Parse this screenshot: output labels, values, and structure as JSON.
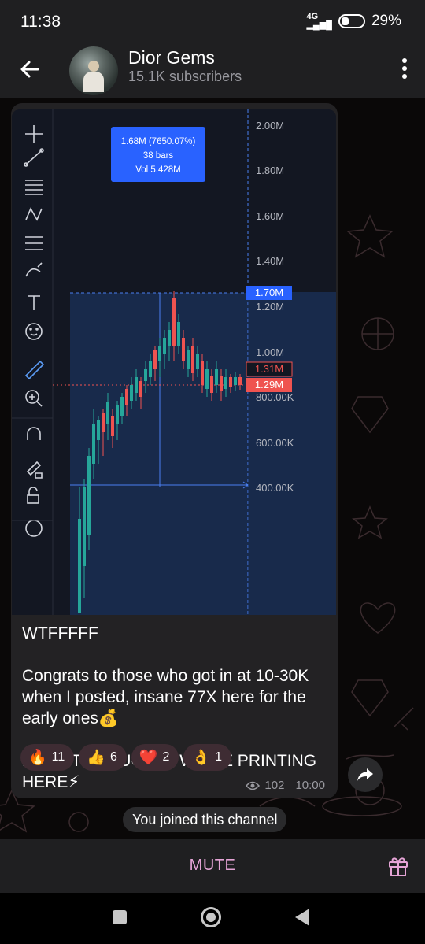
{
  "status": {
    "time": "11:38",
    "network": "4G",
    "battery": "29%"
  },
  "header": {
    "title": "Dior Gems",
    "subtitle": "15.1K subscribers"
  },
  "chart": {
    "tooltip": {
      "line1": "1.68M (7650.07%)",
      "line2": "38 bars",
      "line3": "Vol 5.428M"
    },
    "price_labels": [
      "2.00M",
      "1.80M",
      "1.60M",
      "1.40M",
      "1.20M",
      "1.00M",
      "800.00K",
      "600.00K",
      "400.00K"
    ],
    "highlight_labels": {
      "top": "1.70M",
      "mid": "1.31M",
      "cur": "1.29M"
    }
  },
  "message": {
    "text": "WTFFFFF\n\nCongrats to those who got in at 10-30K when I posted, insane 77X here for the early ones💰\n\nLOCK THE FUCK IN WE’RE PRINTING HERE⚡\n\nNOTIFICATIONS ON!!!",
    "reactions": [
      {
        "emoji": "🔥",
        "count": "11"
      },
      {
        "emoji": "👍",
        "count": "6"
      },
      {
        "emoji": "❤️",
        "count": "2"
      },
      {
        "emoji": "👌",
        "count": "1"
      }
    ],
    "views": "102",
    "time": "10:00"
  },
  "service": {
    "joined": "You joined this channel"
  },
  "bottom": {
    "mute": "MUTE"
  },
  "colors": {
    "accent": "#e5a4d6",
    "up": "#26a69a",
    "down": "#ef5350",
    "highlight": "#2962ff"
  }
}
